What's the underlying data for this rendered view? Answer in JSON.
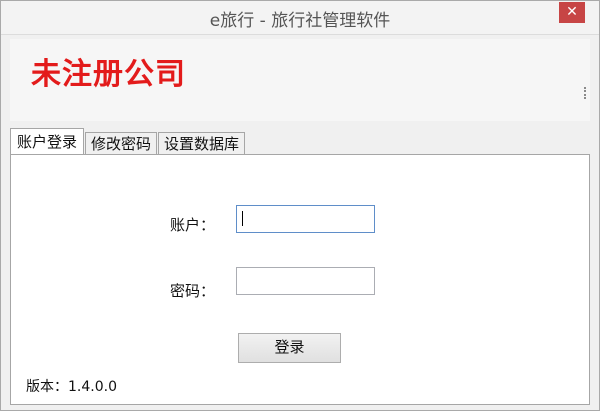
{
  "window": {
    "title": "e旅行 - 旅行社管理软件",
    "close_label": "✕"
  },
  "header": {
    "company_name": "未注册公司"
  },
  "tabs": [
    {
      "label": "账户登录",
      "active": true
    },
    {
      "label": "修改密码",
      "active": false
    },
    {
      "label": "设置数据库",
      "active": false
    }
  ],
  "login": {
    "account_label": "账户：",
    "account_value": "",
    "password_label": "密码：",
    "password_value": "",
    "submit_label": "登录"
  },
  "footer": {
    "version_text": "版本：1.4.0.0"
  },
  "colors": {
    "company_text": "#e31b1b",
    "close_button": "#c74545",
    "focus_border": "#5f8ec9"
  },
  "icons": {
    "close": "close-icon"
  }
}
